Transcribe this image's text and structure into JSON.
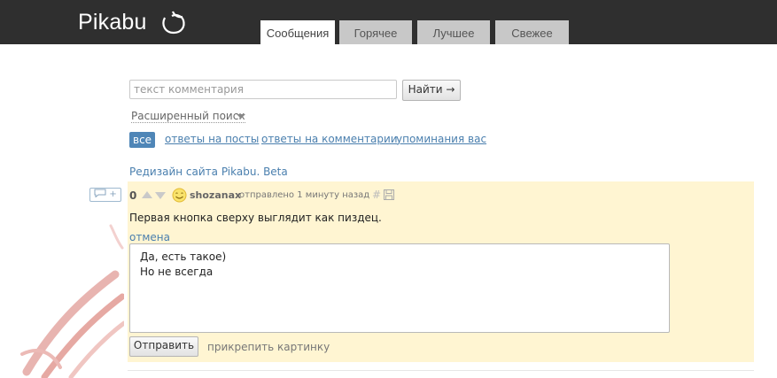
{
  "header": {
    "logo_text": "Pikabu",
    "tabs": [
      {
        "label": "Сообщения",
        "active": true
      },
      {
        "label": "Горячее",
        "active": false
      },
      {
        "label": "Лучшее",
        "active": false
      },
      {
        "label": "Свежее",
        "active": false
      }
    ]
  },
  "search": {
    "placeholder": "текст комментария",
    "value": "",
    "button_label": "Найти →",
    "advanced_label": "Расширенный поиск"
  },
  "filters": {
    "active_label": "все",
    "links": [
      "ответы на посты",
      "ответы на комментарии",
      "упоминания вас"
    ]
  },
  "post": {
    "title": "Редизайн сайта Pikabu. Beta"
  },
  "comment": {
    "reply_counter": "+",
    "rating": "0",
    "username": "shozanax",
    "meta": "отправлено 1 минуту назад",
    "hash": "#",
    "text": "Первая кнопка сверху выглядит как пиздец.",
    "cancel_label": "отмена",
    "reply_value": "Да, есть такое)\nНо не всегда",
    "submit_label": "Отправить",
    "attach_label": "прикрепить картинку"
  },
  "colors": {
    "header_bg": "#2f2f2f",
    "tab_bg": "#c8c8c8",
    "link": "#4a7fae",
    "filter_active_bg": "#4f86b7",
    "comment_bg": "#fff5d2"
  }
}
